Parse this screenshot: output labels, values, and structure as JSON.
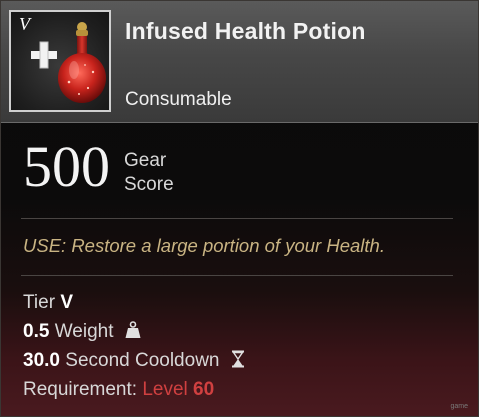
{
  "item": {
    "tier_mark": "V",
    "name": "Infused Health Potion",
    "type": "Consumable"
  },
  "gear_score": {
    "value": "500",
    "label_line1": "Gear",
    "label_line2": "Score"
  },
  "use_text": "USE: Restore a large portion of your Health.",
  "stats": {
    "tier_label": "Tier",
    "tier_value": "V",
    "weight_value": "0.5",
    "weight_label": "Weight",
    "cooldown_value": "30.0",
    "cooldown_label": "Second Cooldown",
    "requirement_label": "Requirement:",
    "requirement_level_label": "Level",
    "requirement_level_value": "60"
  },
  "watermark": "game",
  "colors": {
    "use_text": "#c9b483",
    "requirement": "#d04040",
    "header": "#474747"
  },
  "icons": [
    "potion-icon",
    "plus-icon",
    "weight-icon",
    "hourglass-icon"
  ]
}
